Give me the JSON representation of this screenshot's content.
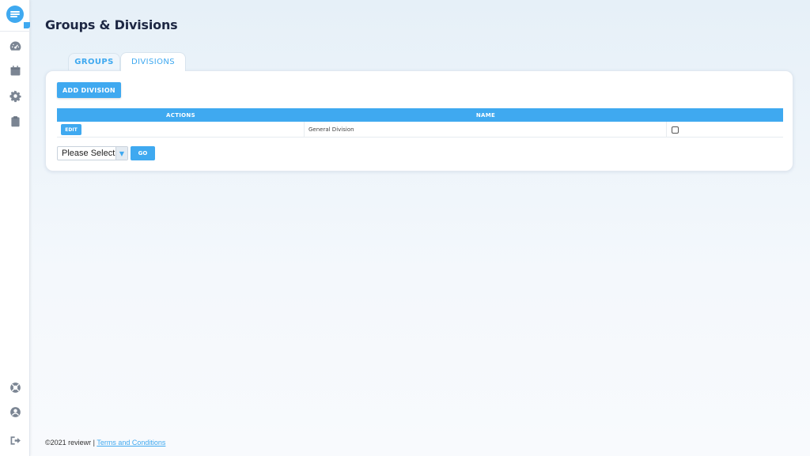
{
  "sidebar": {
    "logo_icon": "chat-bubble-icon",
    "items": [
      {
        "icon": "dashboard-gauge-icon"
      },
      {
        "icon": "calendar-icon"
      },
      {
        "icon": "gear-icon"
      },
      {
        "icon": "clipboard-icon"
      }
    ],
    "bottom_items": [
      {
        "icon": "lifebuoy-icon"
      },
      {
        "icon": "user-circle-icon"
      },
      {
        "icon": "logout-icon"
      }
    ]
  },
  "page": {
    "title": "Groups & Divisions"
  },
  "tabs": [
    {
      "label": "GROUPS",
      "active": false
    },
    {
      "label": "DIVISIONS",
      "active": true
    }
  ],
  "card": {
    "add_button_label": "ADD DIVISION",
    "table": {
      "headers": [
        "ACTIONS",
        "NAME",
        ""
      ],
      "rows": [
        {
          "edit_label": "EDIT",
          "name": "General Division",
          "checked": false
        }
      ]
    },
    "select": {
      "value": "Please Select"
    },
    "go_label": "GO"
  },
  "footer": {
    "copyright": "©2021 reviewr |",
    "link_label": "Terms and Conditions"
  },
  "colors": {
    "accent": "#3fa9f0",
    "title": "#1d2743"
  }
}
